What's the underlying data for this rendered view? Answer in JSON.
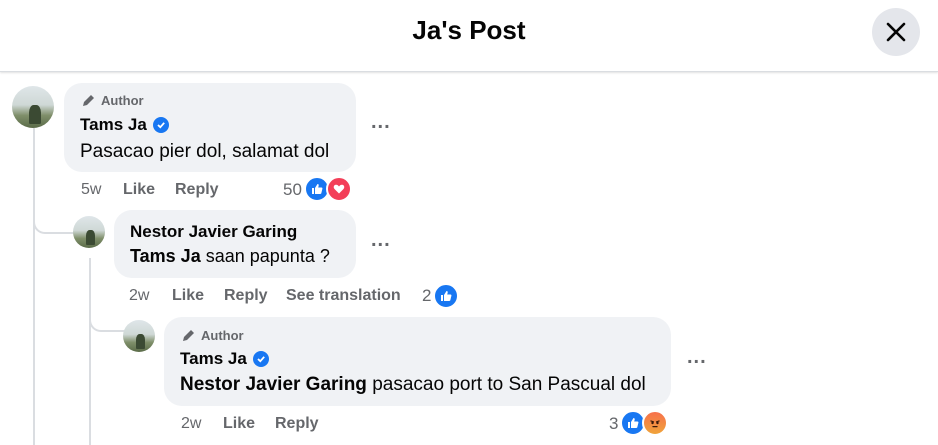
{
  "header": {
    "title": "Ja's Post"
  },
  "comments": [
    {
      "author_tag": "Author",
      "name": "Tams Ja",
      "verified": true,
      "text": "Pasacao pier dol, salamat dol",
      "time": "5w",
      "like": "Like",
      "reply": "Reply",
      "reaction_count": "50",
      "reactions": [
        "like-icon",
        "love-icon"
      ]
    },
    {
      "name": "Nestor Javier Garing",
      "mention": "Tams Ja",
      "text": "saan papunta ?",
      "time": "2w",
      "like": "Like",
      "reply": "Reply",
      "translate": "See translation",
      "reaction_count": "2",
      "reactions": [
        "like-icon"
      ]
    },
    {
      "author_tag": "Author",
      "name": "Tams Ja",
      "verified": true,
      "mention": "Nestor Javier Garing",
      "text": "pasacao port to San Pascual dol",
      "time": "2w",
      "like": "Like",
      "reply": "Reply",
      "reaction_count": "3",
      "reactions": [
        "like-icon",
        "angry-icon"
      ]
    }
  ],
  "more_options": "...",
  "colors": {
    "like": "#1877f2",
    "love": "#f33e58",
    "bubble": "#f0f2f5",
    "meta": "#65676b"
  }
}
